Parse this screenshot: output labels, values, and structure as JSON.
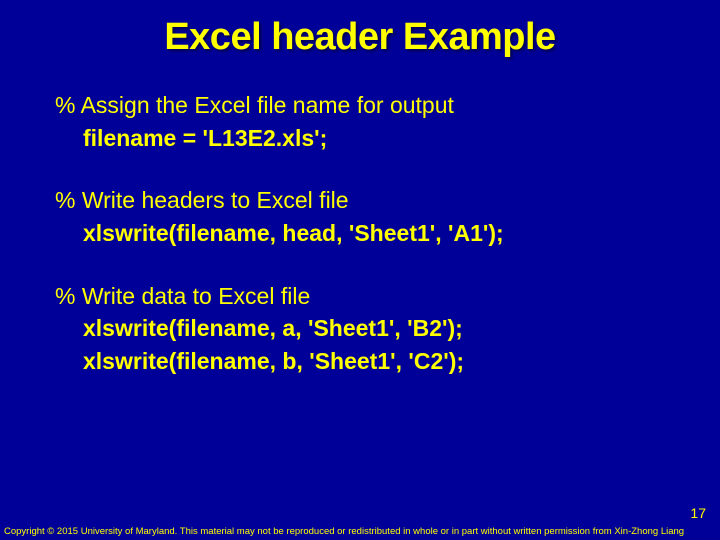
{
  "title": "Excel header Example",
  "blocks": [
    {
      "comment": "% Assign the Excel file name for output",
      "code": [
        "filename = 'L13E2.xls';"
      ]
    },
    {
      "comment": "% Write headers to Excel file",
      "code": [
        "xlswrite(filename, head, 'Sheet1', 'A1');"
      ]
    },
    {
      "comment": "% Write data to Excel file",
      "code": [
        "xlswrite(filename, a, 'Sheet1', 'B2');",
        "xlswrite(filename, b, 'Sheet1', 'C2');"
      ]
    }
  ],
  "pageNumber": "17",
  "copyright": "Copyright © 2015 University of Maryland. This material may not be reproduced or redistributed in whole or in part without written permission from Xin-Zhong Liang"
}
